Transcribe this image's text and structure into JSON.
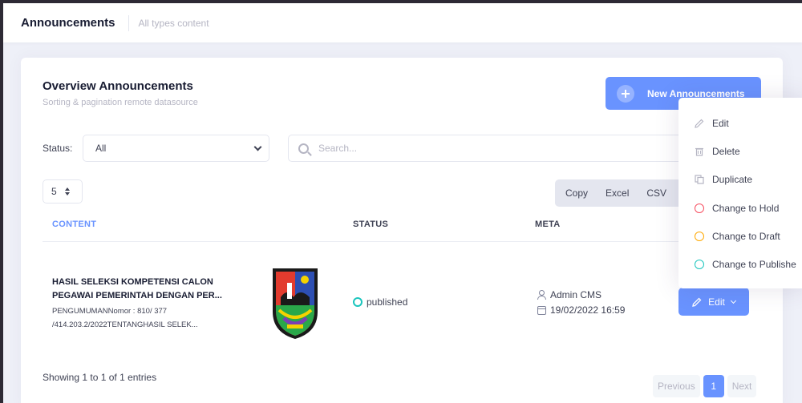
{
  "header": {
    "title": "Announcements",
    "subtitle": "All types content"
  },
  "card": {
    "title": "Overview Announcements",
    "subtitle": "Sorting & pagination remote datasource",
    "new_button_label": "New Announcements"
  },
  "filters": {
    "status_label": "Status:",
    "status_value": "All",
    "search_placeholder": "Search..."
  },
  "page_size": "5",
  "export": {
    "copy": "Copy",
    "excel": "Excel",
    "csv": "CSV"
  },
  "table": {
    "headers": {
      "content": "CONTENT",
      "status": "STATUS",
      "meta": "META"
    },
    "rows": [
      {
        "title": "HASIL SELEKSI KOMPETENSI CALON PEGAWAI PEMERINTAH DENGAN PER...",
        "desc_line1": "PENGUMUMANNomor : 810/ 377",
        "desc_line2": "/414.203.2/2022TENTANGHASIL SELEK...",
        "status": "published",
        "author": "Admin CMS",
        "date": "19/02/2022 16:59",
        "edit_label": "Edit"
      }
    ]
  },
  "footer": {
    "showing": "Showing 1 to 1 of 1 entries",
    "prev": "Previous",
    "page": "1",
    "next": "Next"
  },
  "dropdown": {
    "items": [
      {
        "label": "Edit",
        "icon": "pencil-icon"
      },
      {
        "label": "Delete",
        "icon": "trash-icon"
      },
      {
        "label": "Duplicate",
        "icon": "copy-icon"
      },
      {
        "label": "Change to Hold",
        "color": "#f64e60"
      },
      {
        "label": "Change to Draft",
        "color": "#ffa800"
      },
      {
        "label": "Change to Publishe",
        "color": "#1bc5bd"
      }
    ]
  },
  "colors": {
    "primary": "#6993ff",
    "published": "#1bc5bd"
  }
}
